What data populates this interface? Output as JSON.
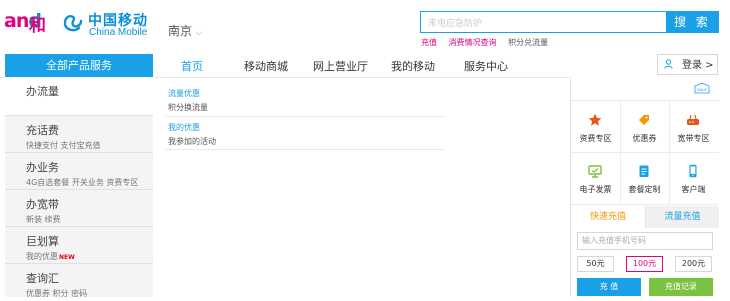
{
  "header": {
    "logo_letters": [
      "a",
      "n",
      "d"
    ],
    "logo_he": "和",
    "brand_cn": "中国移动",
    "brand_en": "China Mobile",
    "city": "南京",
    "search_placeholder": "来电应急防护",
    "search_button": "搜 索",
    "hot_links": [
      "充值",
      "消费情况查询",
      "积分兑流量"
    ]
  },
  "nav": {
    "all_products": "全部产品服务",
    "items": [
      "首页",
      "移动商城",
      "网上营业厅",
      "我的移动",
      "服务中心"
    ],
    "active_index": 0,
    "login": "登录 >"
  },
  "categories": [
    {
      "title": "办流量",
      "sub": ""
    },
    {
      "title": "充话费",
      "sub": "快捷支付  支付宝充值"
    },
    {
      "title": "办业务",
      "sub": "4G自选套餐  开关业务  资费专区"
    },
    {
      "title": "办宽带",
      "sub": "新装  续费"
    },
    {
      "title": "巨划算",
      "sub": "我的优惠",
      "badge": "NEW"
    },
    {
      "title": "查询汇",
      "sub": "优惠券  积分  密码"
    }
  ],
  "submenu": [
    {
      "title": "流量优惠",
      "link": "积分换流量"
    },
    {
      "title": "我的优惠",
      "link": "我参加的活动"
    }
  ],
  "right_panel": {
    "sale_icon": "sale-tag-icon",
    "services": [
      {
        "label": "资费专区",
        "icon": "star-icon",
        "color": "#e8541e"
      },
      {
        "label": "优惠券",
        "icon": "coupon-tag-icon",
        "color": "#f39800"
      },
      {
        "label": "宽带专区",
        "icon": "router-icon",
        "color": "#e8541e"
      },
      {
        "label": "电子发票",
        "icon": "monitor-icon",
        "color": "#7bc142"
      },
      {
        "label": "套餐定制",
        "icon": "clipboard-icon",
        "color": "#19a0e6"
      },
      {
        "label": "客户端",
        "icon": "phone-icon",
        "color": "#19a0e6"
      }
    ],
    "tabs": [
      "快速充值",
      "流量充值"
    ],
    "phone_placeholder": "输入充值手机号码",
    "amounts": [
      "50元",
      "100元",
      "200元"
    ],
    "selected_amount_index": 1,
    "recharge_button": "充 值",
    "records_button": "充值记录"
  }
}
